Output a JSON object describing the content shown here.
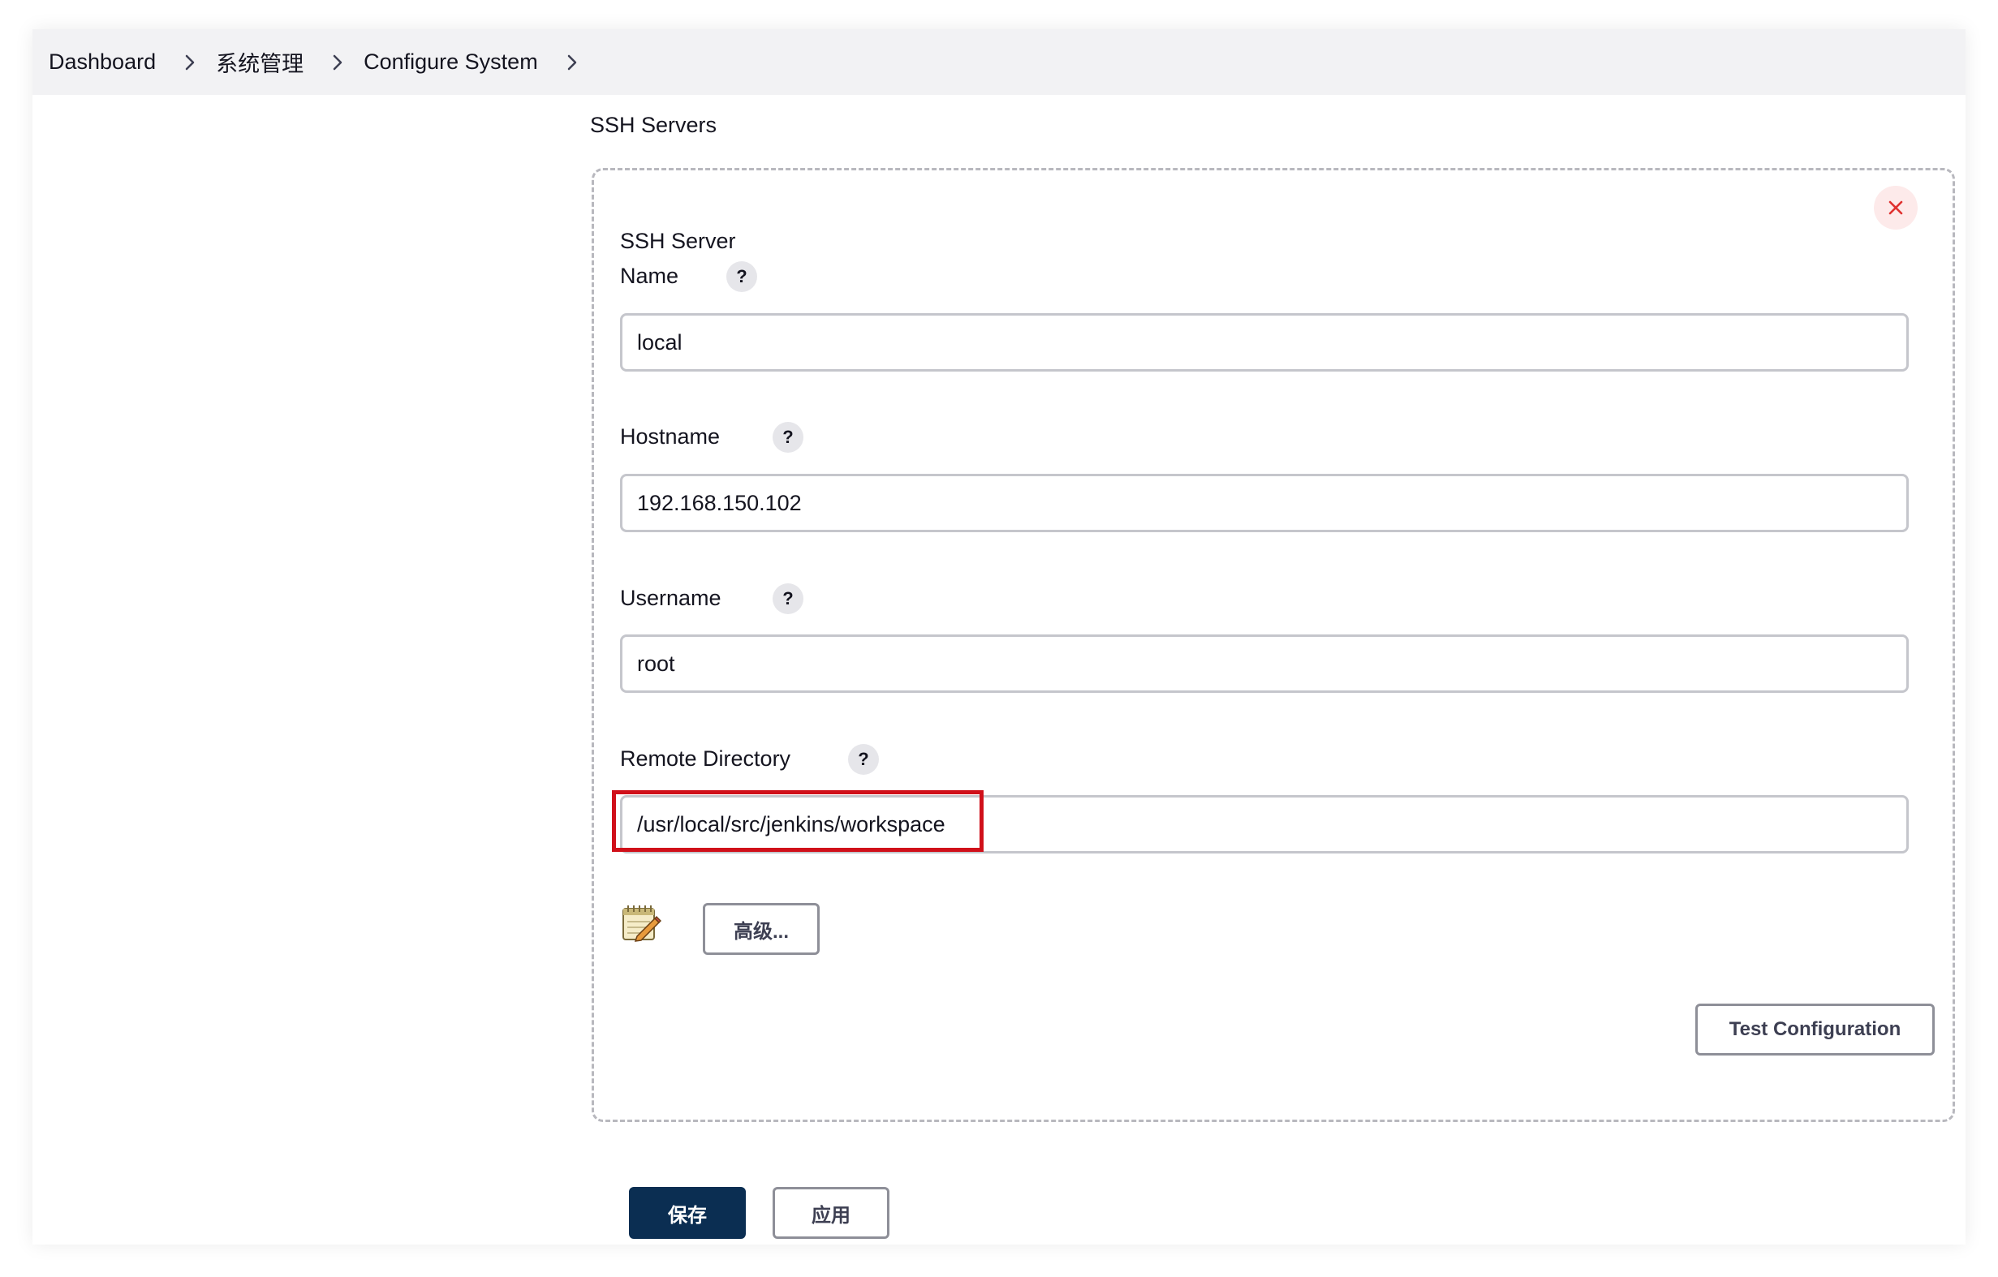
{
  "breadcrumb": {
    "items": [
      "Dashboard",
      "系统管理",
      "Configure System"
    ]
  },
  "section": {
    "title": "SSH Servers"
  },
  "server": {
    "heading": "SSH Server",
    "fields": {
      "name": {
        "label": "Name",
        "value": "local"
      },
      "hostname": {
        "label": "Hostname",
        "value": "192.168.150.102"
      },
      "username": {
        "label": "Username",
        "value": "root"
      },
      "remote_directory": {
        "label": "Remote Directory",
        "value": "/usr/local/src/jenkins/workspace"
      }
    },
    "help_glyph": "?",
    "advanced_label": "高级...",
    "test_label": "Test Configuration"
  },
  "footer": {
    "save_label": "保存",
    "apply_label": "应用"
  },
  "colors": {
    "topbar": "#f2f2f4",
    "primary": "#0b2e52",
    "highlight": "#d0101a",
    "remove_bg": "#fdeaea",
    "remove_icon": "#e0312f"
  },
  "icons": {
    "breadcrumb_separator": "chevron-right-icon",
    "remove": "close-icon",
    "help": "help-icon",
    "notepad": "notepad-icon"
  }
}
